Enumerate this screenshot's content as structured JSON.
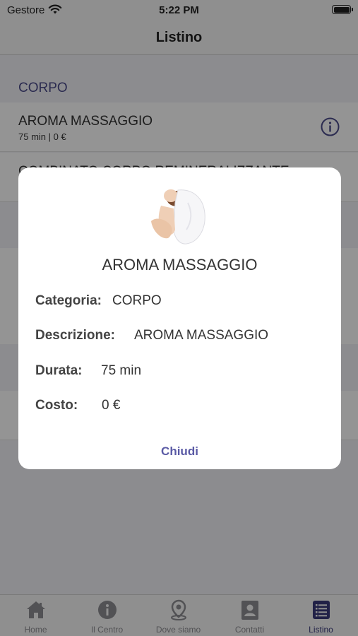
{
  "status_bar": {
    "carrier": "Gestore",
    "time": "5:22 PM"
  },
  "nav": {
    "title": "Listino"
  },
  "list": {
    "section_header": "CORPO",
    "items": [
      {
        "title": "AROMA MASSAGGIO",
        "subtitle": "75 min | 0 €"
      },
      {
        "title": "COMBINATO CORPO REMINERALIZZANTE",
        "subtitle": ""
      }
    ]
  },
  "dialog": {
    "title": "AROMA MASSAGGIO",
    "fields": [
      {
        "label": "Categoria:",
        "value": "CORPO"
      },
      {
        "label": "Descrizione:",
        "value": "AROMA MASSAGGIO"
      },
      {
        "label": "Durata:",
        "value": "75 min"
      },
      {
        "label": "Costo:",
        "value": "0 €"
      }
    ],
    "close_label": "Chiudi"
  },
  "tab_bar": {
    "tabs": [
      {
        "label": "Home",
        "icon": "home-icon"
      },
      {
        "label": "Il Centro",
        "icon": "info-icon"
      },
      {
        "label": "Dove siamo",
        "icon": "location-pin-icon"
      },
      {
        "label": "Contatti",
        "icon": "contact-card-icon"
      },
      {
        "label": "Listino",
        "icon": "list-icon",
        "active": true
      }
    ]
  },
  "colors": {
    "accent": "#4a4a8a",
    "overlay": "rgba(0,0,0,0.42)"
  }
}
